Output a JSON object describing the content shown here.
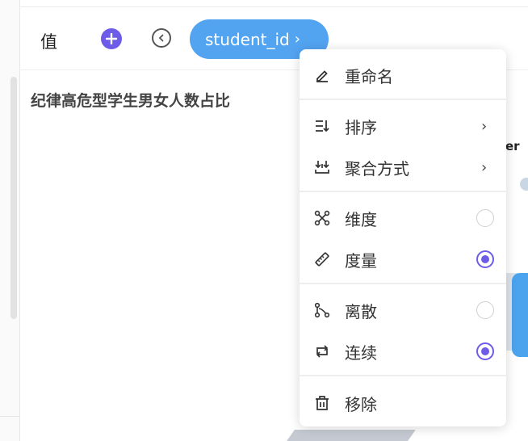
{
  "header": {
    "value_label": "值",
    "field_pill": {
      "label": "student_id",
      "chevron": "›"
    },
    "add_icon": "plus-circle-icon",
    "back_icon": "chevron-left-circle-icon"
  },
  "chart": {
    "title": "纪律高危型学生男女人数占比",
    "legend_fragment": "er"
  },
  "menu": {
    "rename": "重命名",
    "sort": "排序",
    "aggregate": "聚合方式",
    "dimension": {
      "label": "维度",
      "selected": false
    },
    "measure": {
      "label": "度量",
      "selected": true
    },
    "discrete": {
      "label": "离散",
      "selected": false
    },
    "continuous": {
      "label": "连续",
      "selected": true
    },
    "remove": "移除",
    "submenu_arrow": "›"
  },
  "colors": {
    "accent": "#6d5ce8",
    "pill": "#52a3f0"
  }
}
